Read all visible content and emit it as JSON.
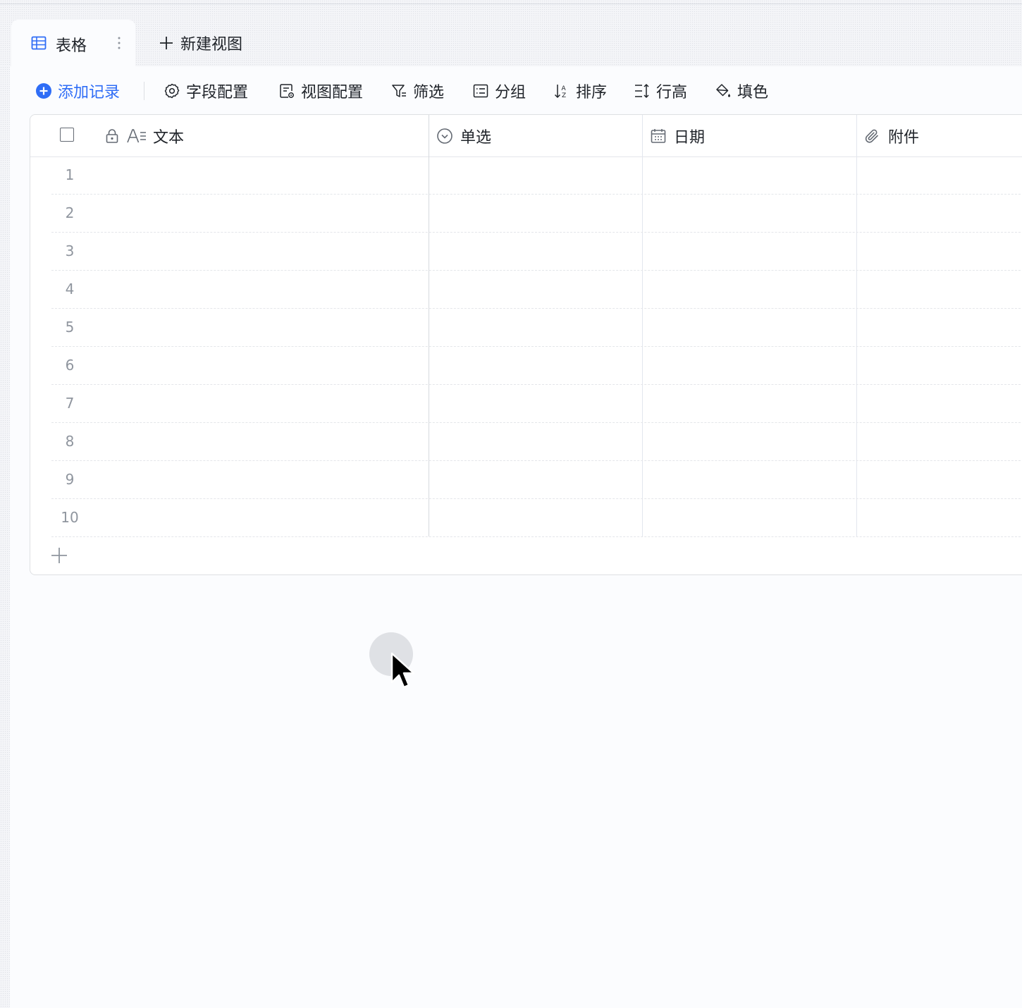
{
  "tabs": {
    "active_label": "表格",
    "new_view_label": "新建视图"
  },
  "toolbar": {
    "add_record": "添加记录",
    "field_config": "字段配置",
    "view_config": "视图配置",
    "filter": "筛选",
    "group": "分组",
    "sort": "排序",
    "row_height": "行高",
    "fill_color": "填色"
  },
  "table": {
    "columns": [
      {
        "label": "文本",
        "icon": "text-field-icon",
        "locked": true
      },
      {
        "label": "单选",
        "icon": "single-select-icon"
      },
      {
        "label": "日期",
        "icon": "calendar-icon"
      },
      {
        "label": "附件",
        "icon": "paperclip-icon"
      }
    ],
    "row_numbers": [
      "1",
      "2",
      "3",
      "4",
      "5",
      "6",
      "7",
      "8",
      "9",
      "10"
    ]
  },
  "colors": {
    "accent": "#2f6df6",
    "text": "#1f2329",
    "muted": "#8f959e"
  }
}
